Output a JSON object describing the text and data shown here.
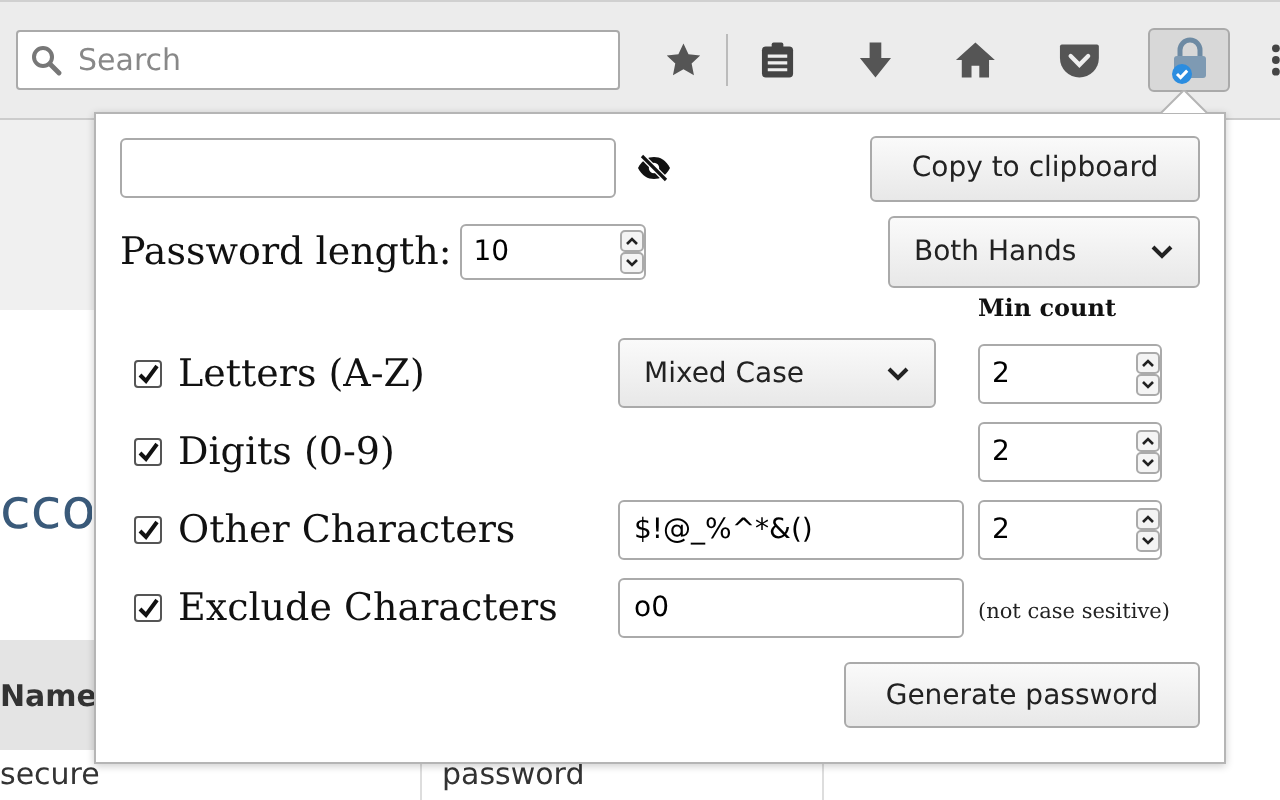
{
  "toolbar": {
    "search": {
      "placeholder": "Search"
    }
  },
  "page": {
    "heading": "cco",
    "table": {
      "columns": [
        "Name"
      ],
      "rows": [
        [
          "secure",
          "password"
        ]
      ]
    }
  },
  "popup": {
    "copy_button": "Copy to clipboard",
    "length_label": "Password length:",
    "length": "10",
    "hand_select": "Both Hands",
    "min_count_label": "Min count",
    "rows": [
      {
        "kind": "select",
        "label": "Letters (A-Z)",
        "checked": true,
        "option": "Mixed Case",
        "count": "2"
      },
      {
        "kind": "plain",
        "label": "Digits (0-9)",
        "checked": true,
        "count": "2"
      },
      {
        "kind": "text",
        "label": "Other Characters",
        "checked": true,
        "value": "$!@_%^*&()",
        "count": "2"
      },
      {
        "kind": "note",
        "label": "Exclude Characters",
        "checked": true,
        "value": "o0",
        "note": "(not case sesitive)"
      }
    ],
    "generate_button": "Generate password"
  }
}
